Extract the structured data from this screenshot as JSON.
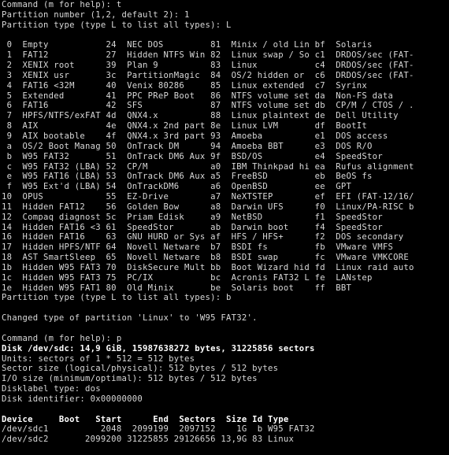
{
  "terminal": {
    "text_color": "#d8d8d8",
    "background": "#000000",
    "lines": [
      "Command (m for help): t",
      "Partition number (1,2, default 2): 1",
      "Partition type (type L to list all types): L",
      "",
      " 0  Empty           24  NEC DOS         81  Minix / old Lin bf  Solaris",
      " 1  FAT12           27  Hidden NTFS Win 82  Linux swap / So c1  DRDOS/sec (FAT-",
      " 2  XENIX root      39  Plan 9          83  Linux           c4  DRDOS/sec (FAT-",
      " 3  XENIX usr       3c  PartitionMagic  84  OS/2 hidden or  c6  DRDOS/sec (FAT-",
      " 4  FAT16 <32M      40  Venix 80286     85  Linux extended  c7  Syrinx",
      " 5  Extended        41  PPC PReP Boot   86  NTFS volume set da  Non-FS data",
      " 6  FAT16           42  SFS             87  NTFS volume set db  CP/M / CTOS / .",
      " 7  HPFS/NTFS/exFAT 4d  QNX4.x          88  Linux plaintext de  Dell Utility",
      " 8  AIX             4e  QNX4.x 2nd part 8e  Linux LVM       df  BootIt",
      " 9  AIX bootable    4f  QNX4.x 3rd part 93  Amoeba          e1  DOS access",
      " a  OS/2 Boot Manag 50  OnTrack DM      94  Amoeba BBT      e3  DOS R/O",
      " b  W95 FAT32       51  OnTrack DM6 Aux 9f  BSD/OS          e4  SpeedStor",
      " c  W95 FAT32 (LBA) 52  CP/M            a0  IBM Thinkpad hi ea  Rufus alignment",
      " e  W95 FAT16 (LBA) 53  OnTrack DM6 Aux a5  FreeBSD         eb  BeOS fs",
      " f  W95 Ext'd (LBA) 54  OnTrackDM6      a6  OpenBSD         ee  GPT",
      "10  OPUS            55  EZ-Drive        a7  NeXTSTEP        ef  EFI (FAT-12/16/",
      "11  Hidden FAT12    56  Golden Bow      a8  Darwin UFS      f0  Linux/PA-RISC b",
      "12  Compaq diagnost 5c  Priam Edisk     a9  NetBSD          f1  SpeedStor",
      "14  Hidden FAT16 <3 61  SpeedStor       ab  Darwin boot     f4  SpeedStor",
      "16  Hidden FAT16    63  GNU HURD or Sys af  HFS / HFS+      f2  DOS secondary",
      "17  Hidden HPFS/NTF 64  Novell Netware  b7  BSDI fs         fb  VMware VMFS",
      "18  AST SmartSleep  65  Novell Netware  b8  BSDI swap       fc  VMware VMKCORE",
      "1b  Hidden W95 FAT3 70  DiskSecure Mult bb  Boot Wizard hid fd  Linux raid auto",
      "1c  Hidden W95 FAT3 75  PC/IX           bc  Acronis FAT32 L fe  LANstep",
      "1e  Hidden W95 FAT1 80  Old Minix       be  Solaris boot    ff  BBT",
      "Partition type (type L to list all types): b",
      "",
      "Changed type of partition 'Linux' to 'W95 FAT32'.",
      "",
      "Command (m for help): p",
      "Disk /dev/sdc: 14,9 GiB, 15987638272 bytes, 31225856 sectors",
      "Units: sectors of 1 * 512 = 512 bytes",
      "Sector size (logical/physical): 512 bytes / 512 bytes",
      "I/O size (minimum/optimal): 512 bytes / 512 bytes",
      "Disklabel type: dos",
      "Disk identifier: 0x00000000",
      "",
      "Device     Boot   Start      End  Sectors  Size Id Type",
      "/dev/sdc1          2048  2099199  2097152    1G  b W95 FAT32",
      "/dev/sdc2       2099200 31225855 29126656 13,9G 83 Linux"
    ]
  }
}
